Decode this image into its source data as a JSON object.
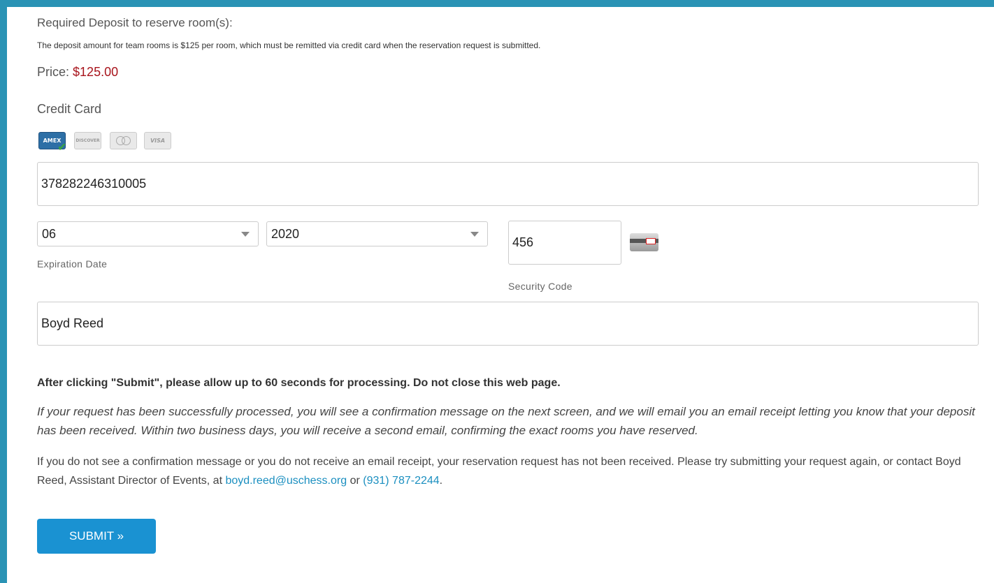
{
  "deposit": {
    "heading": "Required Deposit to reserve room(s):",
    "description": "The deposit amount for team rooms is $125 per room, which must be remitted via credit card when the reservation request is submitted.",
    "price_label": "Price:",
    "price_value": "$125.00"
  },
  "payment": {
    "section_label": "Credit Card",
    "card_types": [
      {
        "name": "AMEX",
        "selected": true
      },
      {
        "name": "DISCOVER",
        "selected": false
      },
      {
        "name": "MasterCard",
        "selected": false
      },
      {
        "name": "VISA",
        "selected": false
      }
    ],
    "card_number": "378282246310005",
    "exp_month": "06",
    "exp_year": "2020",
    "exp_label": "Expiration Date",
    "security_code": "456",
    "security_label": "Security Code",
    "cardholder_name": "Boyd Reed"
  },
  "notes": {
    "processing": "After clicking \"Submit\", please allow up to 60 seconds for processing. Do not close this web page.",
    "confirmation": "If your request has been successfully processed, you will see a confirmation message on the next screen, and we will email you an email receipt letting you know that your deposit has been received. Within two business days, you will receive a second email, confirming the exact rooms you have reserved.",
    "contact_prefix": "If you do not see a confirmation message or you do not receive an email receipt, your reservation request has not been received. Please try submitting your request again, or contact Boyd Reed, Assistant Director of Events, at ",
    "contact_email": "boyd.reed@uschess.org",
    "contact_or": " or ",
    "contact_phone": "(931) 787-2244",
    "contact_suffix": "."
  },
  "submit_label": "SUBMIT »",
  "colors": {
    "background": "#2a93b5",
    "price": "#a8141c",
    "link": "#1b8fc0",
    "button": "#1a92d2"
  }
}
